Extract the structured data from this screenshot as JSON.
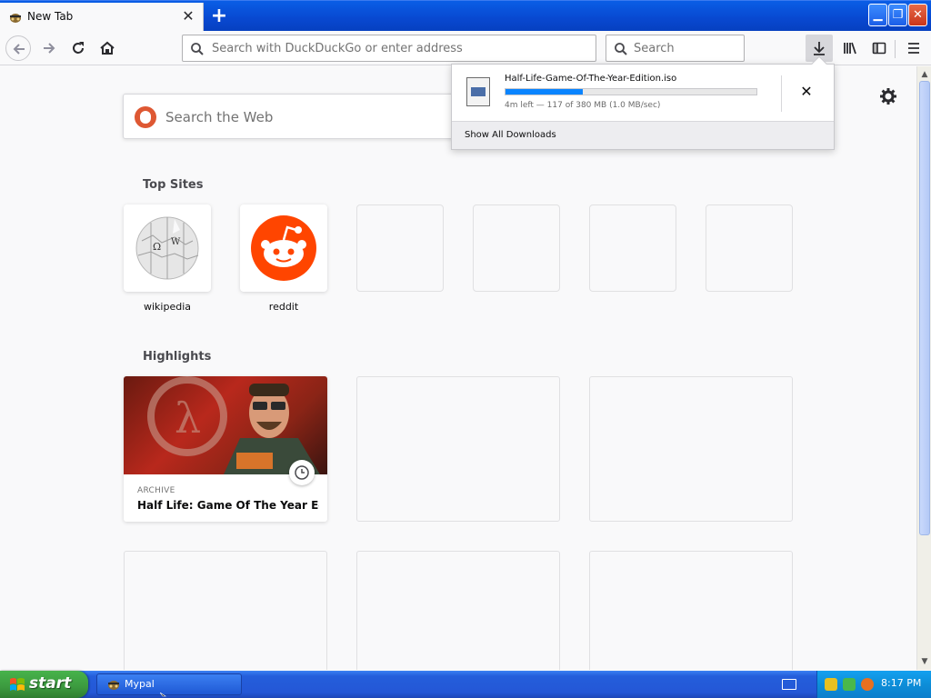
{
  "tab": {
    "title": "New Tab",
    "close": "✕"
  },
  "toolbar": {
    "new_tab": "+",
    "url_placeholder": "Search with DuckDuckGo or enter address",
    "search_placeholder": "Search"
  },
  "window_controls": {
    "minimize": "▁",
    "maximize": "❐",
    "close": "✕"
  },
  "page": {
    "web_search_placeholder": "Search the Web",
    "top_sites_title": "Top Sites",
    "top_sites": [
      {
        "label": "wikipedia"
      },
      {
        "label": "reddit"
      }
    ],
    "highlights_title": "Highlights",
    "highlight": {
      "category": "ARCHIVE",
      "title": "Half Life: Game Of The Year Edit..."
    }
  },
  "downloads": {
    "file_name": "Half-Life-Game-Of-The-Year-Edition.iso",
    "progress": 0.308,
    "status": "4m left — 117 of 380 MB (1.0 MB/sec)",
    "cancel": "✕",
    "show_all": "Show All Downloads"
  },
  "taskbar": {
    "start_label": "start",
    "task_label": "Mypal",
    "clock": "8:17 PM"
  },
  "colors": {
    "accent": "#0a84ff",
    "reddit": "#ff4500",
    "duckduckgo": "#de5833"
  }
}
